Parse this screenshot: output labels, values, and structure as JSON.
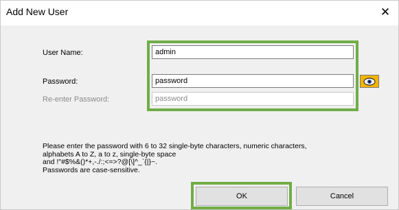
{
  "window": {
    "title": "Add New User",
    "close_glyph": "✕"
  },
  "form": {
    "username_label": "User Name:",
    "username_value": "admin",
    "password_label": "Password:",
    "password_value": "password",
    "reenter_label": "Re-enter Password:",
    "reenter_placeholder": "password",
    "show_password_icon": "eye-icon"
  },
  "info": {
    "line1": "Please enter the password with 6 to 32 single-byte characters, numeric characters,",
    "line2": "alphabets A to Z, a to z, single-byte space",
    "line3": "and !\"#$%&()*+,-./:;<=>?@[\\]^_`{|}~.",
    "line4": "Passwords are case-sensitive."
  },
  "buttons": {
    "ok_label": "OK",
    "cancel_label": "Cancel"
  },
  "colors": {
    "highlight_frame": "#70ad47",
    "eye_button": "#f2b400"
  }
}
